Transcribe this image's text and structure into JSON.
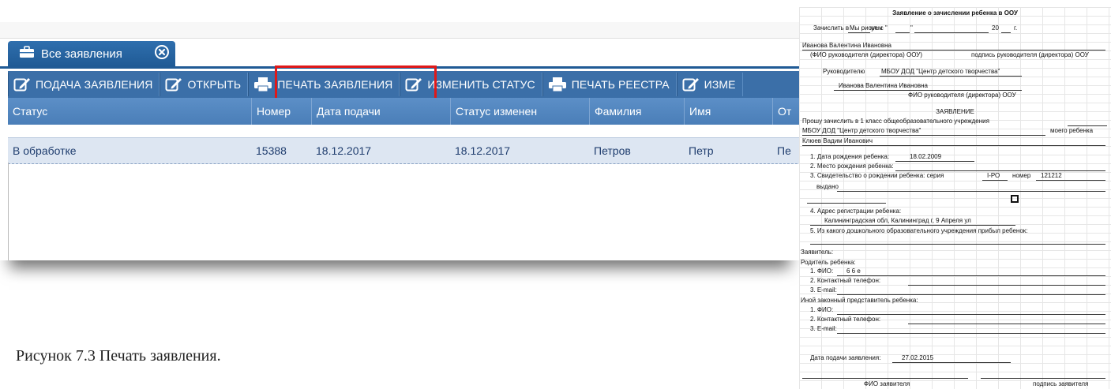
{
  "tab": {
    "label": "Все заявления"
  },
  "toolbar": {
    "submit": "ПОДАЧА ЗАЯВЛЕНИЯ",
    "open": "ОТКРЫТЬ",
    "print_application": "ПЕЧАТЬ ЗАЯВЛЕНИЯ",
    "change_status": "ИЗМЕНИТЬ СТАТУС",
    "print_registry": "ПЕЧАТЬ РЕЕСТРА",
    "edit_partial": "ИЗМЕ"
  },
  "table": {
    "columns": [
      "Статус",
      "Номер",
      "Дата подачи",
      "Статус изменен",
      "Фамилия",
      "Имя",
      "От"
    ],
    "rows": [
      [
        "В обработке",
        "15388",
        "18.12.2017",
        "18.12.2017",
        "Петров",
        "Петр",
        "Пе"
      ]
    ]
  },
  "form": {
    "title": "Заявление о зачислении ребенка в ООУ",
    "enroll_prefix": "Зачислить в",
    "enroll_value": "Мы рисуем",
    "enroll_class": "кл. с \"",
    "enroll_quote": "\"",
    "enroll_year": "20",
    "enroll_g": "г.",
    "director_name": "Иванова Валентина Ивановна",
    "director_caption": "(ФИО руководителя (директора) ООУ)",
    "director_sign_caption": "подпись руководителя (директора) ООУ",
    "to_head_label": "Руководителю",
    "org_name": "МБОУ ДОД \"Центр детского творчества\"",
    "head_name": "Иванова Валентина Ивановна",
    "head_caption": "ФИО руководителя (директора) ООУ",
    "heading": "ЗАЯВЛЕНИЕ",
    "request_text": "Прошу зачислить в 1 класс общеобразовательного учреждения",
    "org_name2": "МБОУ ДОД \"Центр детского творчества\"",
    "my_child": "моего ребенка",
    "child_name": "Клюев Вадим Иванович",
    "birth_date_label": "1. Дата рождения ребенка:",
    "birth_date": "18.02.2009",
    "birth_place_label": "2. Место рождения ребенка:",
    "certificate_label": "3. Свидетельство о рождении ребенка: серия",
    "certificate_series": "I-РО",
    "certificate_number_label": "номер",
    "certificate_number": "121212",
    "issued_label": "выдано",
    "address_label": "4. Адрес регистрации ребенка:",
    "address_value": "Калининградская обл, Калининград г, 9 Апреля ул",
    "preschool_label": "5. Из какого дошкольного образовательного учреждения прибыл ребенок:",
    "applicant_label": "Заявитель:",
    "parent_label": "Родитель ребенка:",
    "parent_fio_label": "1. ФИО:",
    "parent_fio": "6 6 е",
    "parent_phone_label": "2. Контактный телефон:",
    "parent_email_label": "3. E-mail:",
    "other_rep_label": "Иной законный представитель ребенка:",
    "other_fio_label": "1. ФИО:",
    "other_phone_label": "2. Контактный телефон:",
    "other_email_label": "3. E-mail:",
    "submit_date_label": "Дата подачи заявления:",
    "submit_date": "27.02.2015",
    "applicant_fio_caption": "ФИО заявителя",
    "applicant_sign_caption": "подпись заявителя"
  },
  "caption": "Рисунок 7.3  Печать заявления."
}
